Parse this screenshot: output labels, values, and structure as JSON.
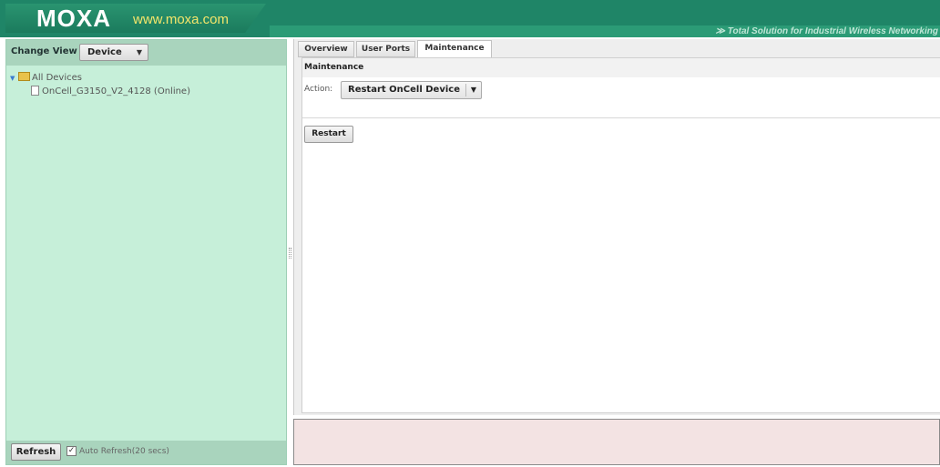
{
  "header": {
    "logo_text": "MOXA",
    "logo_url": "www.moxa.com",
    "tagline": "≫ Total Solution for Industrial Wireless Networking"
  },
  "left_panel": {
    "change_view_label": "Change View",
    "view_select_value": "Device",
    "tree": {
      "root_label": "All Devices",
      "children": [
        {
          "label": "OnCell_G3150_V2_4128 (Online)"
        }
      ]
    },
    "refresh_label": "Refresh",
    "auto_refresh_label": "Auto Refresh(20 secs)",
    "auto_refresh_checked": true
  },
  "right_panel": {
    "tabs": [
      {
        "label": "Overview",
        "active": false
      },
      {
        "label": "User Ports",
        "active": false
      },
      {
        "label": "Maintenance",
        "active": true
      }
    ],
    "section_title": "Maintenance",
    "action_label": "Action:",
    "action_value": "Restart OnCell Device",
    "restart_label": "Restart"
  },
  "colors": {
    "header_green": "#1f8567",
    "left_panel_bg": "#c6efd9",
    "log_panel_bg": "#f3e3e3"
  },
  "icons": [
    "folder-icon",
    "document-icon",
    "chevron-down-icon",
    "checkbox-check-icon",
    "tree-expand-icon"
  ]
}
